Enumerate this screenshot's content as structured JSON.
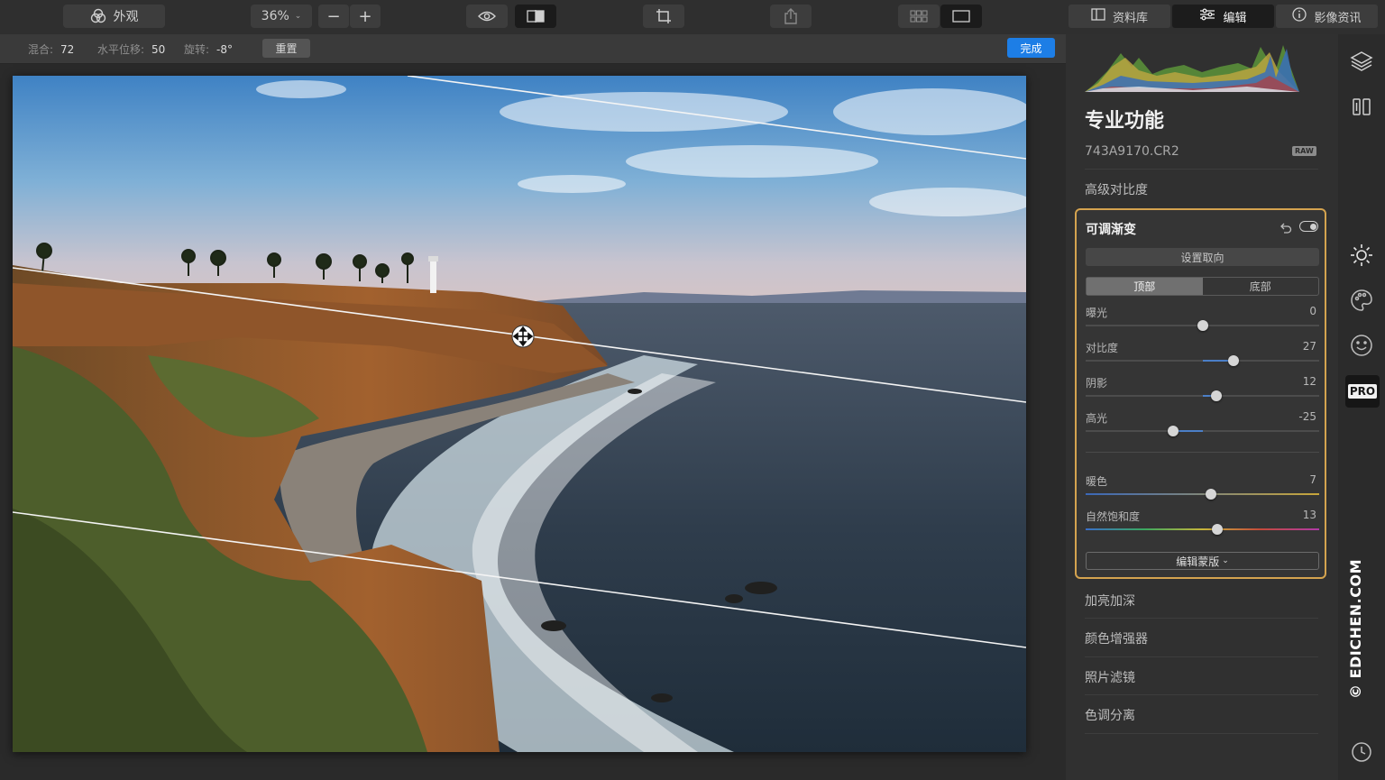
{
  "toolbar": {
    "appearance_label": "外观",
    "zoom_value": "36%",
    "zoom_out": "−",
    "zoom_in": "+"
  },
  "panel_tabs": [
    {
      "label": "资料库",
      "icon": "library-icon"
    },
    {
      "label": "编辑",
      "icon": "sliders-icon"
    },
    {
      "label": "影像资讯",
      "icon": "info-icon"
    }
  ],
  "subbar": {
    "blend_label": "混合:",
    "blend_value": "72",
    "hshift_label": "水平位移:",
    "hshift_value": "50",
    "rotate_label": "旋转:",
    "rotate_value": "-8°",
    "reset_label": "重置",
    "done_label": "完成"
  },
  "panel": {
    "title": "专业功能",
    "filename": "743A9170.CR2",
    "raw_badge": "RAW",
    "advanced_contrast": "高级对比度",
    "gradient": {
      "title": "可调渐变",
      "orientation_button": "设置取向",
      "seg_top": "顶部",
      "seg_bottom": "底部",
      "sliders": [
        {
          "label": "曝光",
          "value": "0",
          "pos": 0.5
        },
        {
          "label": "对比度",
          "value": "27",
          "pos": 0.635
        },
        {
          "label": "阴影",
          "value": "12",
          "pos": 0.56
        },
        {
          "label": "高光",
          "value": "-25",
          "pos": 0.375
        }
      ],
      "color_sliders": [
        {
          "label": "暖色",
          "value": "7",
          "pos": 0.535
        },
        {
          "label": "自然饱和度",
          "value": "13",
          "pos": 0.565
        }
      ],
      "edit_mask": "编辑蒙版"
    },
    "sections": [
      "加亮加深",
      "颜色增强器",
      "照片滤镜",
      "色调分离"
    ]
  },
  "rail": {
    "pro_label": "PRO",
    "icons": [
      "layers-icon",
      "compare-icon",
      "sun-icon",
      "palette-icon",
      "face-icon",
      "pro-icon",
      "history-icon"
    ]
  },
  "watermark": "© EDICHEN.COM"
}
